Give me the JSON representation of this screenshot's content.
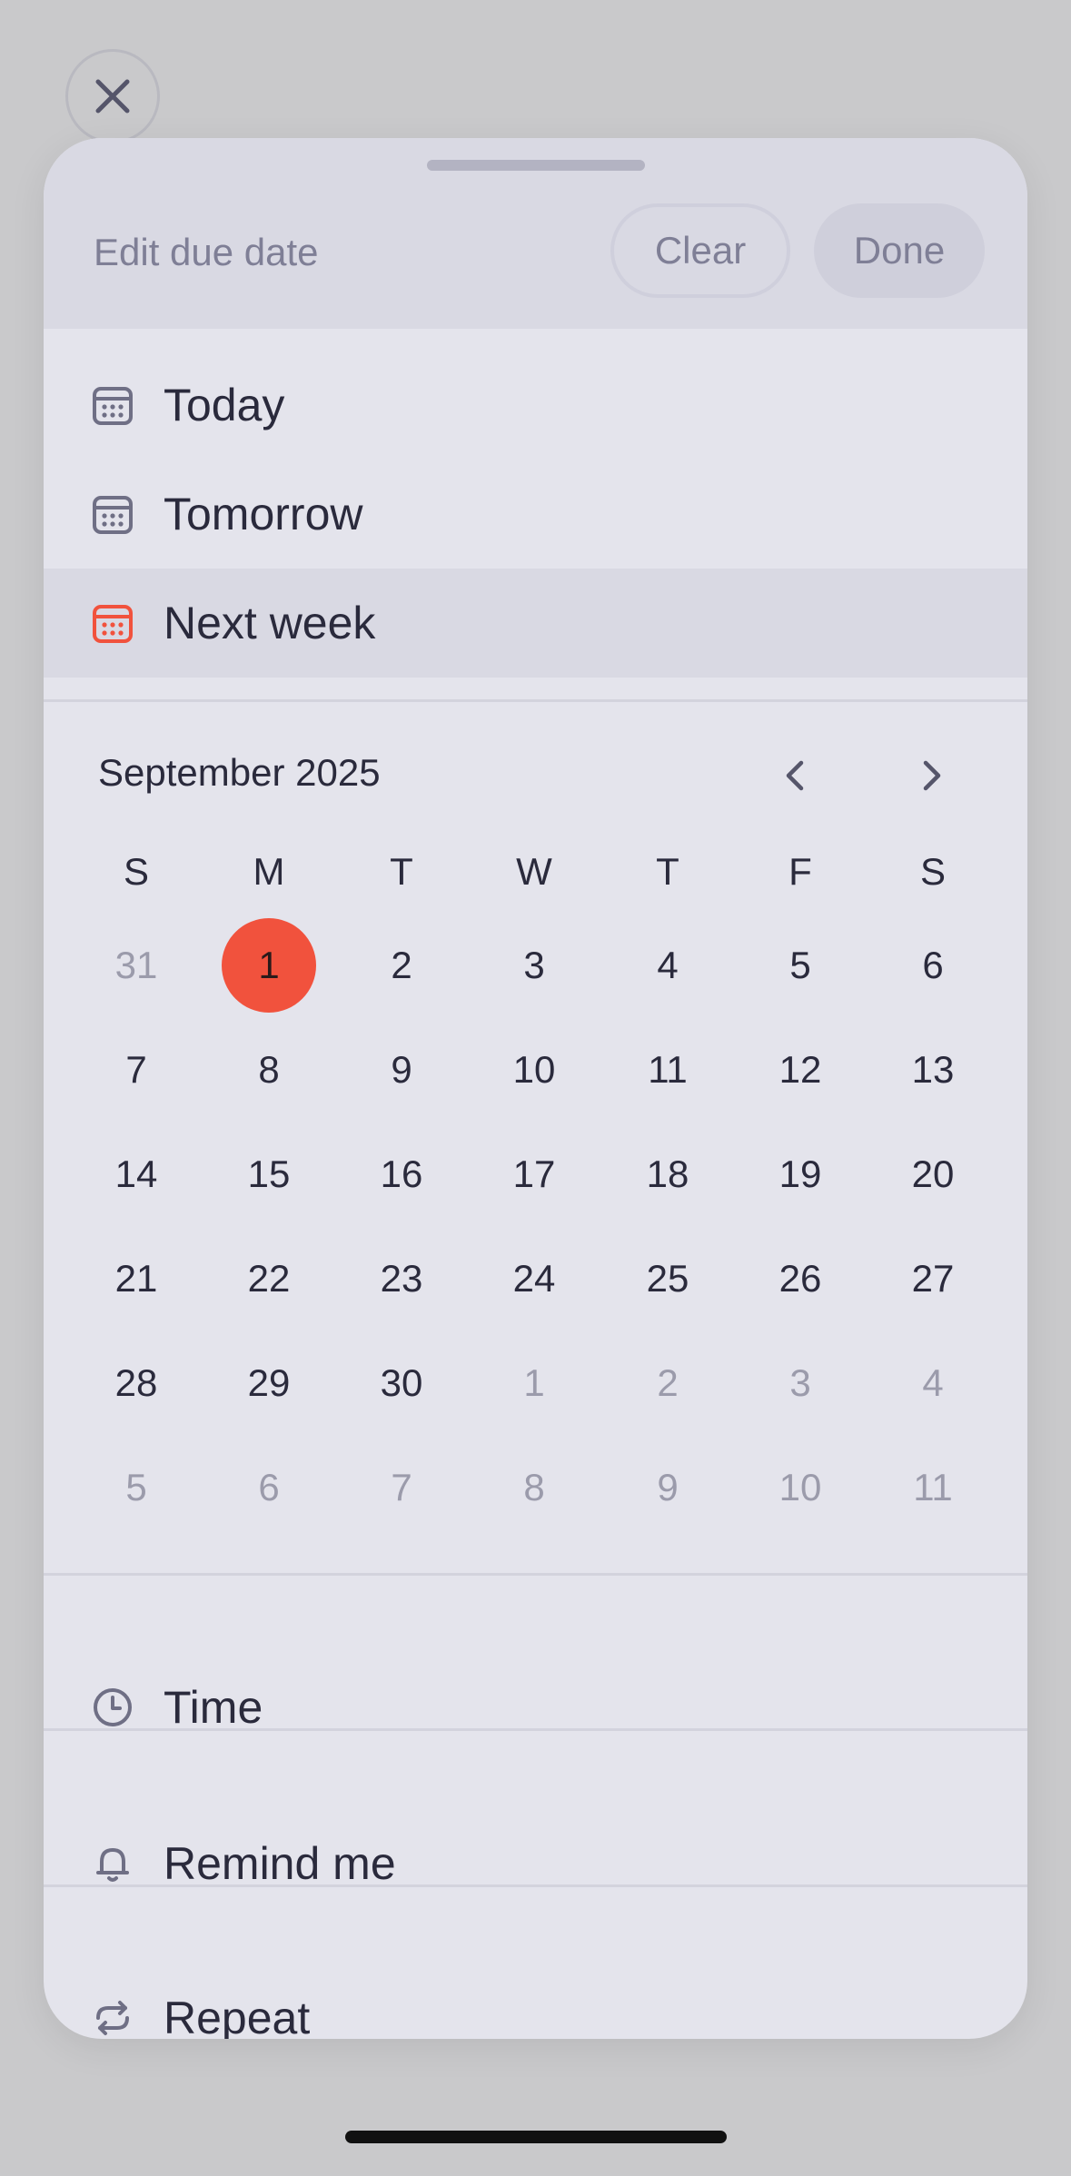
{
  "header": {
    "title": "Edit due date",
    "clear_label": "Clear",
    "done_label": "Done"
  },
  "quick_options": [
    {
      "label": "Today",
      "icon": "calendar-icon"
    },
    {
      "label": "Tomorrow",
      "icon": "calendar-icon"
    },
    {
      "label": "Next week",
      "icon": "calendar-icon",
      "selected": true
    }
  ],
  "calendar": {
    "month_title": "September 2025",
    "weekdays": [
      "S",
      "M",
      "T",
      "W",
      "T",
      "F",
      "S"
    ],
    "weeks": [
      [
        {
          "d": "31",
          "m": true
        },
        {
          "d": "1",
          "sel": true
        },
        {
          "d": "2"
        },
        {
          "d": "3"
        },
        {
          "d": "4"
        },
        {
          "d": "5"
        },
        {
          "d": "6"
        }
      ],
      [
        {
          "d": "7"
        },
        {
          "d": "8"
        },
        {
          "d": "9"
        },
        {
          "d": "10"
        },
        {
          "d": "11"
        },
        {
          "d": "12"
        },
        {
          "d": "13"
        }
      ],
      [
        {
          "d": "14"
        },
        {
          "d": "15"
        },
        {
          "d": "16"
        },
        {
          "d": "17"
        },
        {
          "d": "18"
        },
        {
          "d": "19"
        },
        {
          "d": "20"
        }
      ],
      [
        {
          "d": "21"
        },
        {
          "d": "22"
        },
        {
          "d": "23"
        },
        {
          "d": "24"
        },
        {
          "d": "25"
        },
        {
          "d": "26"
        },
        {
          "d": "27"
        }
      ],
      [
        {
          "d": "28"
        },
        {
          "d": "29"
        },
        {
          "d": "30"
        },
        {
          "d": "1",
          "m": true
        },
        {
          "d": "2",
          "m": true
        },
        {
          "d": "3",
          "m": true
        },
        {
          "d": "4",
          "m": true
        }
      ],
      [
        {
          "d": "5",
          "m": true
        },
        {
          "d": "6",
          "m": true
        },
        {
          "d": "7",
          "m": true
        },
        {
          "d": "8",
          "m": true
        },
        {
          "d": "9",
          "m": true
        },
        {
          "d": "10",
          "m": true
        },
        {
          "d": "11",
          "m": true
        }
      ]
    ]
  },
  "options": {
    "time_label": "Time",
    "remind_label": "Remind me",
    "repeat_label": "Repeat"
  },
  "colors": {
    "accent": "#f1523d",
    "icon": "#6f6f85"
  }
}
